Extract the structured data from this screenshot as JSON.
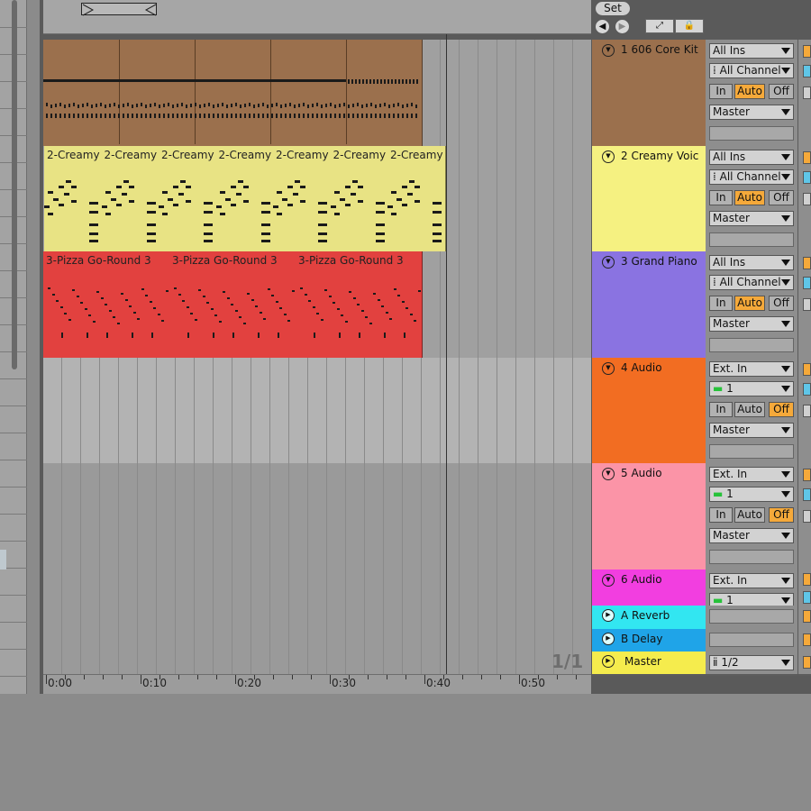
{
  "header": {
    "set_label": "Set",
    "back_icon": "arrow-left-icon",
    "forward_icon": "arrow-right-icon"
  },
  "tracks": [
    {
      "name": "1 606 Core Kit",
      "color": "#9b704d",
      "input_type": "All Ins",
      "input_channel": "All Channel",
      "monitor": "Auto",
      "output": "Master"
    },
    {
      "name": "2 Creamy Voic",
      "color": "#f5f181",
      "input_type": "All Ins",
      "input_channel": "All Channel",
      "monitor": "Auto",
      "output": "Master"
    },
    {
      "name": "3 Grand Piano",
      "color": "#8a73e1",
      "input_type": "All Ins",
      "input_channel": "All Channel",
      "monitor": "Auto",
      "output": "Master"
    },
    {
      "name": "4 Audio",
      "color": "#f26d22",
      "input_type": "Ext. In",
      "input_channel": "1",
      "monitor": "Off",
      "output": "Master"
    },
    {
      "name": "5 Audio",
      "color": "#fb94a7",
      "input_type": "Ext. In",
      "input_channel": "1",
      "monitor": "Off",
      "output": "Master"
    },
    {
      "name": "6 Audio",
      "color": "#f23ee0",
      "input_type": "Ext. In",
      "input_channel": "1"
    }
  ],
  "returns": [
    {
      "name": "A Reverb",
      "color": "#32e6f1"
    },
    {
      "name": "B Delay",
      "color": "#1fa4e8"
    }
  ],
  "master": {
    "name": "Master",
    "color": "#f5ec4d",
    "output": "1/2"
  },
  "monitor_labels": {
    "in": "In",
    "auto": "Auto",
    "off": "Off"
  },
  "clips": {
    "track1": [
      {
        "title": ""
      }
    ],
    "track2": [
      {
        "title": "2-Creamy"
      },
      {
        "title": "2-Creamy"
      },
      {
        "title": "2-Creamy"
      },
      {
        "title": "2-Creamy"
      },
      {
        "title": "2-Creamy"
      },
      {
        "title": "2-Creamy"
      },
      {
        "title": "2-Creamy"
      }
    ],
    "track3": [
      {
        "title": "3-Pizza Go-Round 3"
      },
      {
        "title": "3-Pizza Go-Round 3"
      },
      {
        "title": "3-Pizza Go-Round 3"
      }
    ]
  },
  "clip_colors": {
    "track1": "#9b704d",
    "track2": "#e8e384",
    "track3": "#e2413f"
  },
  "ruler": {
    "labels": [
      "0:00",
      "0:10",
      "0:20",
      "0:30",
      "0:40",
      "0:50"
    ]
  },
  "page_indicator": "1/1"
}
